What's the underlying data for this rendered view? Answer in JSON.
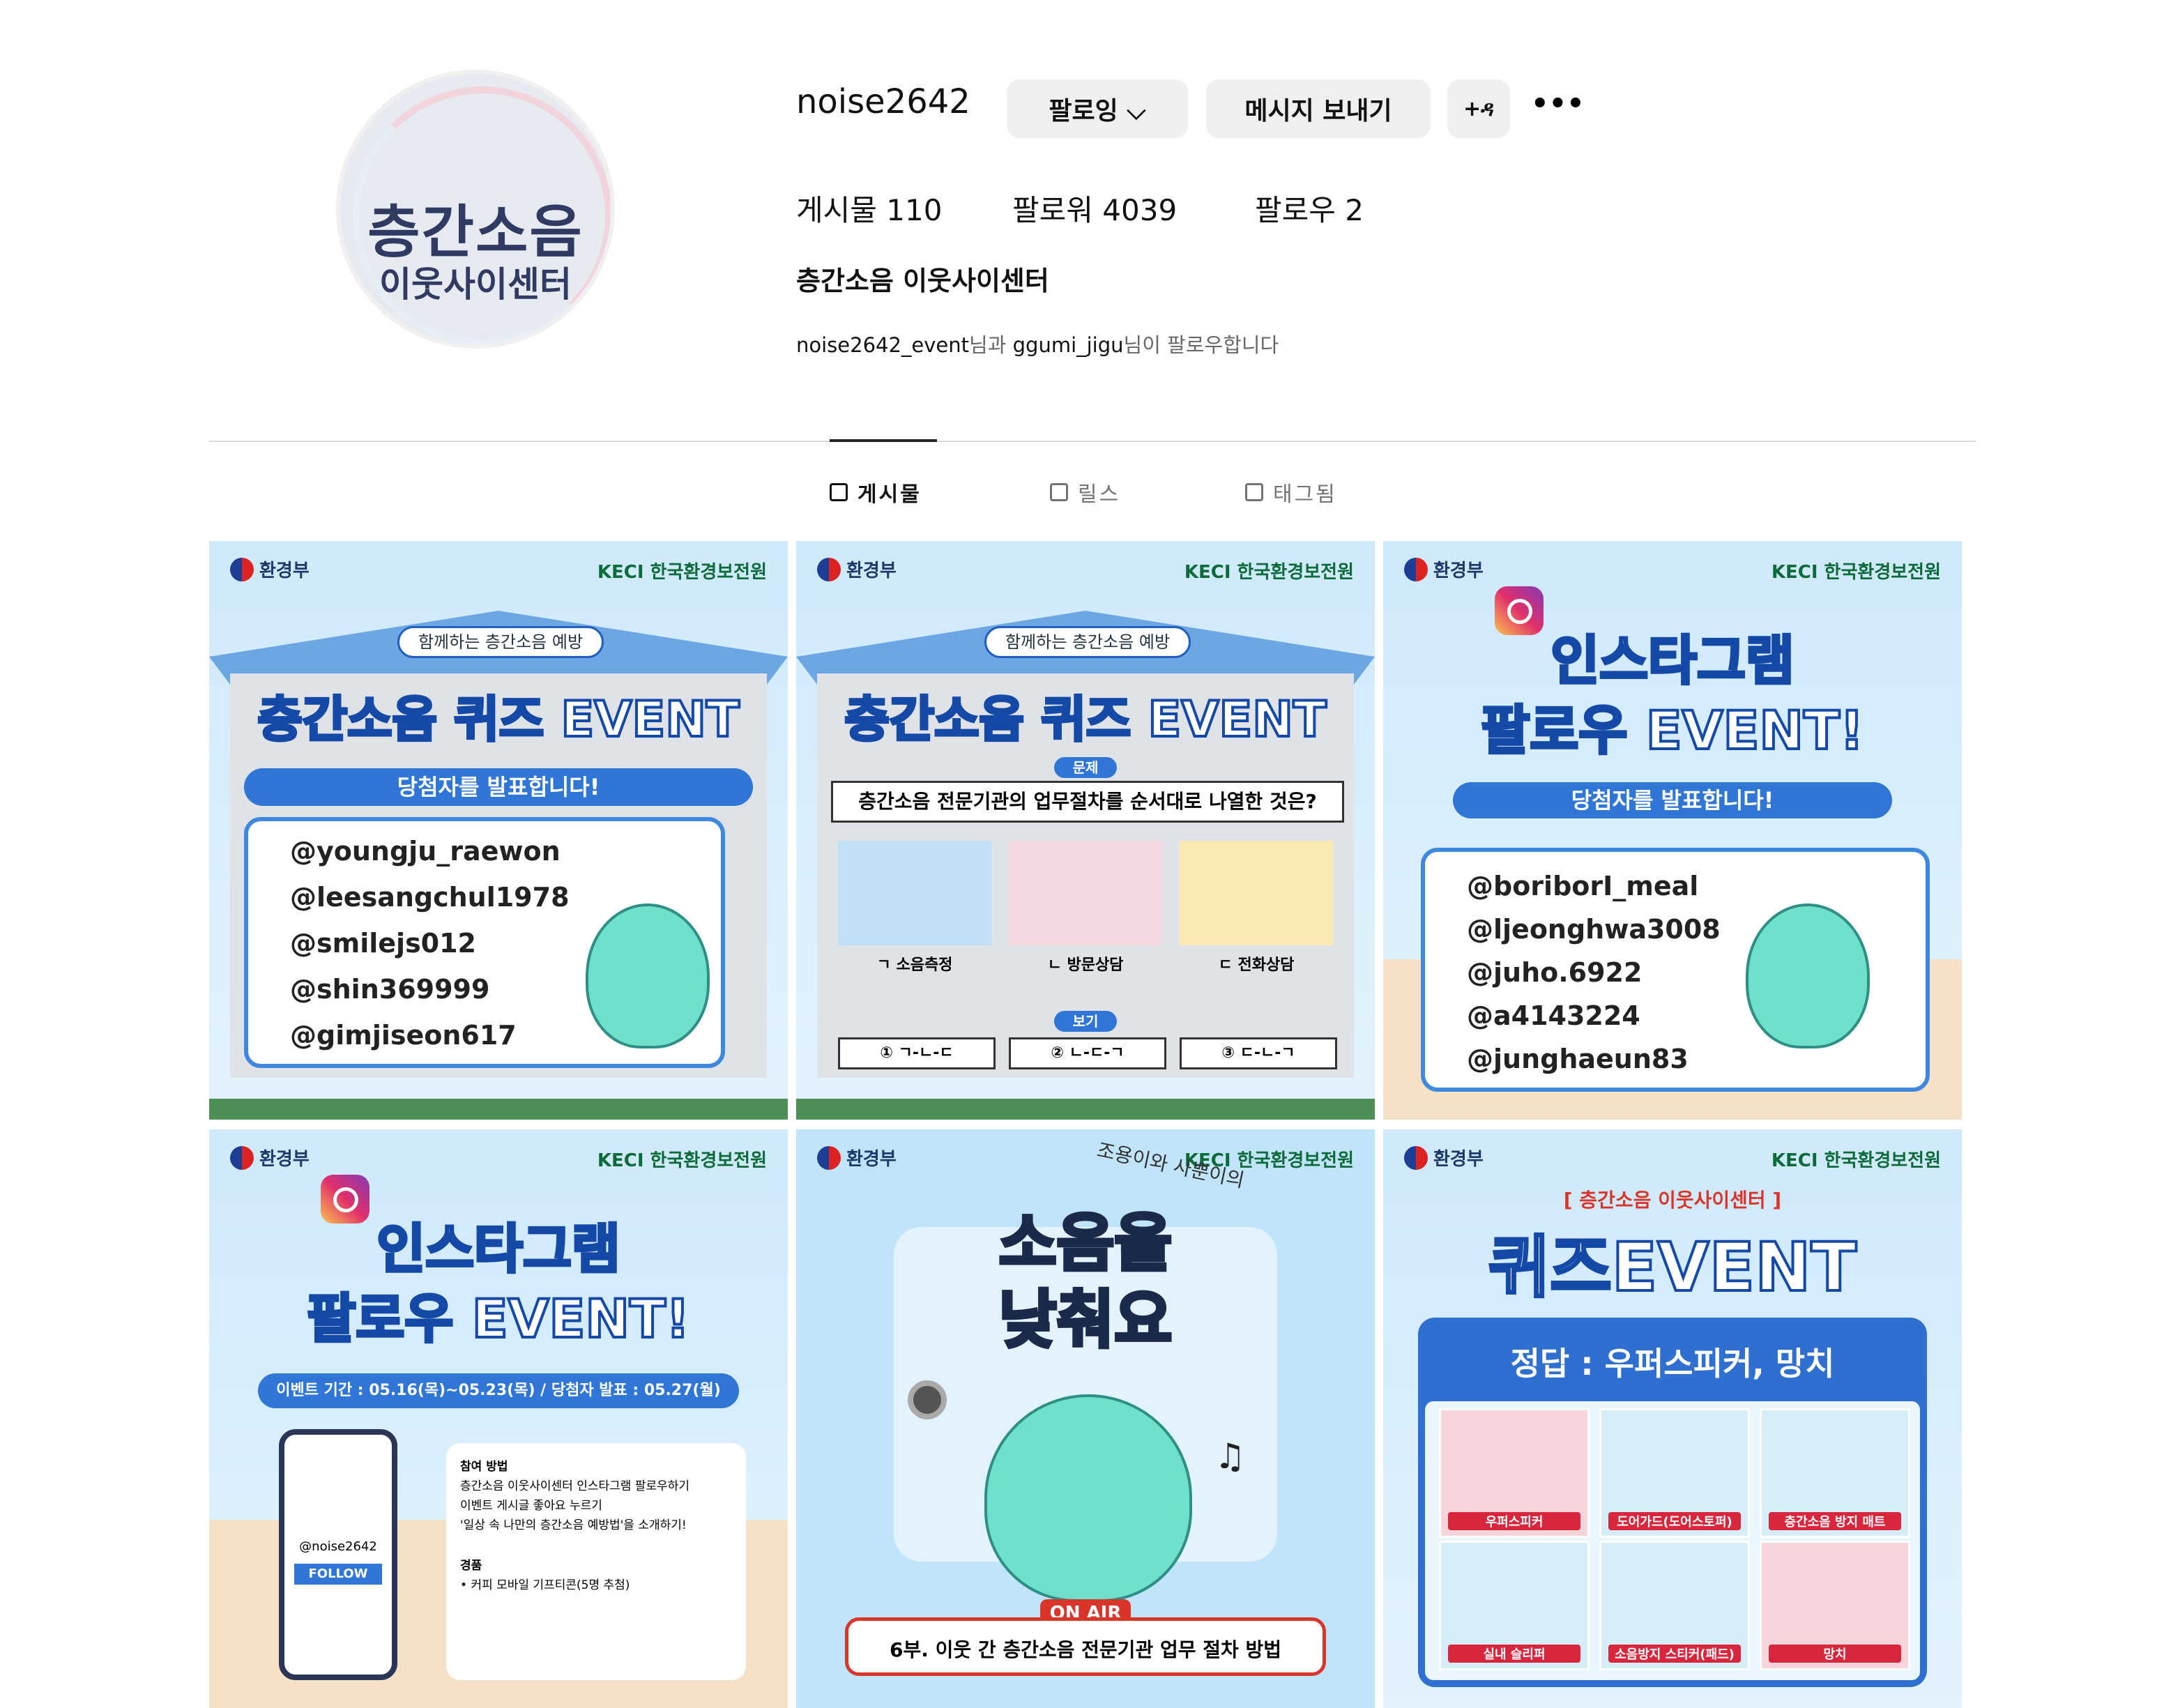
{
  "profile": {
    "username": "noise2642",
    "full_name": "층간소음 이웃사이센터",
    "avatar": {
      "line1": "층간소음",
      "line2": "이웃사이센터"
    },
    "buttons": {
      "following": "팔로잉 ⌵",
      "message": "메시지 보내기",
      "add_user": "+ዳ",
      "more": "•••"
    },
    "stats": [
      {
        "label": "게시물",
        "value": "110"
      },
      {
        "label": "팔로워",
        "value": "4039"
      },
      {
        "label": "팔로우",
        "value": "2"
      }
    ],
    "followed_by": {
      "user1": "noise2642_event",
      "mid": "님과 ",
      "user2": "ggumi_jigu",
      "end": "님이 팔로우합니다"
    }
  },
  "tabs": [
    {
      "label": "게시물",
      "icon": "grid-icon"
    },
    {
      "label": "릴스",
      "icon": "reels-icon"
    },
    {
      "label": "태그됨",
      "icon": "tagged-icon"
    }
  ],
  "posts": {
    "common": {
      "gov": "환경부",
      "keci": "KECI 한국환경보전원"
    },
    "p1": {
      "pill": "함께하는 층간소음 예방",
      "title": "층간소음 퀴즈 EVENT",
      "banner": "당첨자를 발표합니다!",
      "winners": [
        "@youngju_raewon",
        "@leesangchul1978",
        "@smilejs012",
        "@shin369999",
        "@gimjiseon617"
      ]
    },
    "p2": {
      "pill": "함께하는 층간소음 예방",
      "title": "층간소음 퀴즈 EVENT",
      "tag": "문제",
      "question": "층간소음 전문기관의 업무절차를 순서대로 나열한 것은?",
      "options": [
        "ㄱ 소음측정",
        "ㄴ 방문상담",
        "ㄷ 전화상담"
      ],
      "tag2": "보기",
      "answers": [
        "① ㄱ-ㄴ-ㄷ",
        "② ㄴ-ㄷ-ㄱ",
        "③ ㄷ-ㄴ-ㄱ"
      ]
    },
    "p3": {
      "title1": "인스타그램",
      "title2": "팔로우 EVENT!",
      "banner": "당첨자를 발표합니다!",
      "winners": [
        "@boriborI_meal",
        "@ljeonghwa3008",
        "@juho.6922",
        "@a4143224",
        "@junghaeun83"
      ]
    },
    "p4": {
      "title1": "인스타그램",
      "title2": "팔로우 EVENT!",
      "banner": "이벤트 기간 : 05.16(목)~05.23(목) / 당첨자 발표 : 05.27(월)",
      "phone_user": "@noise2642",
      "follow": "FOLLOW",
      "method_title": "참여 방법",
      "steps": [
        "층간소음 이웃사이센터 인스타그램 팔로우하기",
        "이벤트 게시글 좋아요 누르기",
        "'일상 속 나만의 층간소음 예방법'을 소개하기!"
      ],
      "prize_title": "경품",
      "prize": "• 커피 모바일 기프티콘(5명 추첨)"
    },
    "p5": {
      "subtitle": "조용이와 사뿐이의",
      "title1": "소음을",
      "title2": "낮춰요",
      "onair": "ON AIR",
      "caption": "6부. 이웃 간 층간소음 전문기관 업무 절차 방법"
    },
    "p6": {
      "header": "[ 층간소음 이웃사이센터 ]",
      "title": "퀴즈EVENT",
      "answer": "정답 : 우퍼스피커, 망치",
      "items": [
        "우퍼스피커",
        "도어가드(도어스토퍼)",
        "층간소음 방지 매트",
        "실내 슬리퍼",
        "소음방지 스티커(패드)",
        "망치"
      ]
    }
  },
  "colors": {
    "button_bg": "#efefef",
    "divider": "#dbdbdb",
    "accent_blue": "#2f76d6",
    "title_stroke": "#1549a8"
  }
}
